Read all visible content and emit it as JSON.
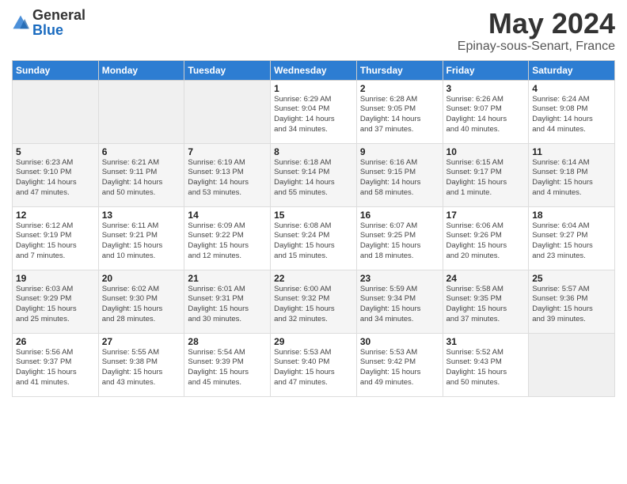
{
  "header": {
    "logo_general": "General",
    "logo_blue": "Blue",
    "title": "May 2024",
    "location": "Epinay-sous-Senart, France"
  },
  "weekdays": [
    "Sunday",
    "Monday",
    "Tuesday",
    "Wednesday",
    "Thursday",
    "Friday",
    "Saturday"
  ],
  "weeks": [
    [
      {
        "day": "",
        "info": ""
      },
      {
        "day": "",
        "info": ""
      },
      {
        "day": "",
        "info": ""
      },
      {
        "day": "1",
        "info": "Sunrise: 6:29 AM\nSunset: 9:04 PM\nDaylight: 14 hours\nand 34 minutes."
      },
      {
        "day": "2",
        "info": "Sunrise: 6:28 AM\nSunset: 9:05 PM\nDaylight: 14 hours\nand 37 minutes."
      },
      {
        "day": "3",
        "info": "Sunrise: 6:26 AM\nSunset: 9:07 PM\nDaylight: 14 hours\nand 40 minutes."
      },
      {
        "day": "4",
        "info": "Sunrise: 6:24 AM\nSunset: 9:08 PM\nDaylight: 14 hours\nand 44 minutes."
      }
    ],
    [
      {
        "day": "5",
        "info": "Sunrise: 6:23 AM\nSunset: 9:10 PM\nDaylight: 14 hours\nand 47 minutes."
      },
      {
        "day": "6",
        "info": "Sunrise: 6:21 AM\nSunset: 9:11 PM\nDaylight: 14 hours\nand 50 minutes."
      },
      {
        "day": "7",
        "info": "Sunrise: 6:19 AM\nSunset: 9:13 PM\nDaylight: 14 hours\nand 53 minutes."
      },
      {
        "day": "8",
        "info": "Sunrise: 6:18 AM\nSunset: 9:14 PM\nDaylight: 14 hours\nand 55 minutes."
      },
      {
        "day": "9",
        "info": "Sunrise: 6:16 AM\nSunset: 9:15 PM\nDaylight: 14 hours\nand 58 minutes."
      },
      {
        "day": "10",
        "info": "Sunrise: 6:15 AM\nSunset: 9:17 PM\nDaylight: 15 hours\nand 1 minute."
      },
      {
        "day": "11",
        "info": "Sunrise: 6:14 AM\nSunset: 9:18 PM\nDaylight: 15 hours\nand 4 minutes."
      }
    ],
    [
      {
        "day": "12",
        "info": "Sunrise: 6:12 AM\nSunset: 9:19 PM\nDaylight: 15 hours\nand 7 minutes."
      },
      {
        "day": "13",
        "info": "Sunrise: 6:11 AM\nSunset: 9:21 PM\nDaylight: 15 hours\nand 10 minutes."
      },
      {
        "day": "14",
        "info": "Sunrise: 6:09 AM\nSunset: 9:22 PM\nDaylight: 15 hours\nand 12 minutes."
      },
      {
        "day": "15",
        "info": "Sunrise: 6:08 AM\nSunset: 9:24 PM\nDaylight: 15 hours\nand 15 minutes."
      },
      {
        "day": "16",
        "info": "Sunrise: 6:07 AM\nSunset: 9:25 PM\nDaylight: 15 hours\nand 18 minutes."
      },
      {
        "day": "17",
        "info": "Sunrise: 6:06 AM\nSunset: 9:26 PM\nDaylight: 15 hours\nand 20 minutes."
      },
      {
        "day": "18",
        "info": "Sunrise: 6:04 AM\nSunset: 9:27 PM\nDaylight: 15 hours\nand 23 minutes."
      }
    ],
    [
      {
        "day": "19",
        "info": "Sunrise: 6:03 AM\nSunset: 9:29 PM\nDaylight: 15 hours\nand 25 minutes."
      },
      {
        "day": "20",
        "info": "Sunrise: 6:02 AM\nSunset: 9:30 PM\nDaylight: 15 hours\nand 28 minutes."
      },
      {
        "day": "21",
        "info": "Sunrise: 6:01 AM\nSunset: 9:31 PM\nDaylight: 15 hours\nand 30 minutes."
      },
      {
        "day": "22",
        "info": "Sunrise: 6:00 AM\nSunset: 9:32 PM\nDaylight: 15 hours\nand 32 minutes."
      },
      {
        "day": "23",
        "info": "Sunrise: 5:59 AM\nSunset: 9:34 PM\nDaylight: 15 hours\nand 34 minutes."
      },
      {
        "day": "24",
        "info": "Sunrise: 5:58 AM\nSunset: 9:35 PM\nDaylight: 15 hours\nand 37 minutes."
      },
      {
        "day": "25",
        "info": "Sunrise: 5:57 AM\nSunset: 9:36 PM\nDaylight: 15 hours\nand 39 minutes."
      }
    ],
    [
      {
        "day": "26",
        "info": "Sunrise: 5:56 AM\nSunset: 9:37 PM\nDaylight: 15 hours\nand 41 minutes."
      },
      {
        "day": "27",
        "info": "Sunrise: 5:55 AM\nSunset: 9:38 PM\nDaylight: 15 hours\nand 43 minutes."
      },
      {
        "day": "28",
        "info": "Sunrise: 5:54 AM\nSunset: 9:39 PM\nDaylight: 15 hours\nand 45 minutes."
      },
      {
        "day": "29",
        "info": "Sunrise: 5:53 AM\nSunset: 9:40 PM\nDaylight: 15 hours\nand 47 minutes."
      },
      {
        "day": "30",
        "info": "Sunrise: 5:53 AM\nSunset: 9:42 PM\nDaylight: 15 hours\nand 49 minutes."
      },
      {
        "day": "31",
        "info": "Sunrise: 5:52 AM\nSunset: 9:43 PM\nDaylight: 15 hours\nand 50 minutes."
      },
      {
        "day": "",
        "info": ""
      }
    ]
  ]
}
